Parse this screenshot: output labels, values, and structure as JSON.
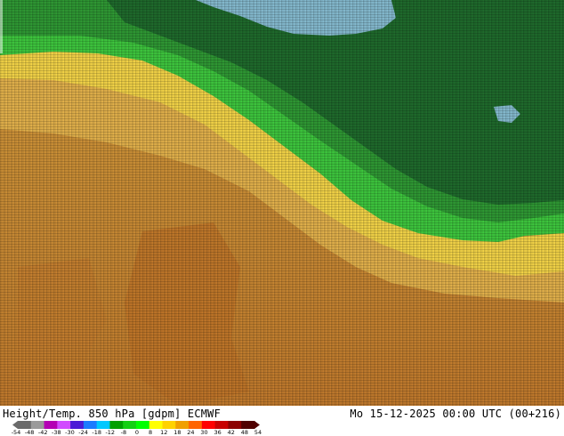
{
  "footer": {
    "title": "Height/Temp. 850 hPa [gdpm] ECMWF",
    "valid_time": "Mo 15-12-2025 00:00 UTC (00+216)"
  },
  "legend": {
    "ticks": [
      "-54",
      "-48",
      "-42",
      "-38",
      "-30",
      "-24",
      "-18",
      "-12",
      "-8",
      "0",
      "8",
      "12",
      "18",
      "24",
      "30",
      "36",
      "42",
      "48",
      "54"
    ],
    "colors": [
      "#6a6a6a",
      "#9a9a9a",
      "#b400b4",
      "#d14bff",
      "#4b1bd6",
      "#1b7bff",
      "#00c8ff",
      "#00a000",
      "#13d013",
      "#00ff00",
      "#ffff00",
      "#ffd200",
      "#f0a000",
      "#ff6400",
      "#ff0000",
      "#c80000",
      "#8c0000",
      "#500000"
    ]
  },
  "map": {
    "regions": {
      "cold_blue": "#7fb6cc",
      "dark_green": "#1f6a2a",
      "mid_green": "#2f9a2f",
      "bright_green": "#3ed23e",
      "yellow": "#f3d14a",
      "gold": "#e2b14a",
      "brown": "#c9903a",
      "dark_brown": "#b77830"
    }
  }
}
